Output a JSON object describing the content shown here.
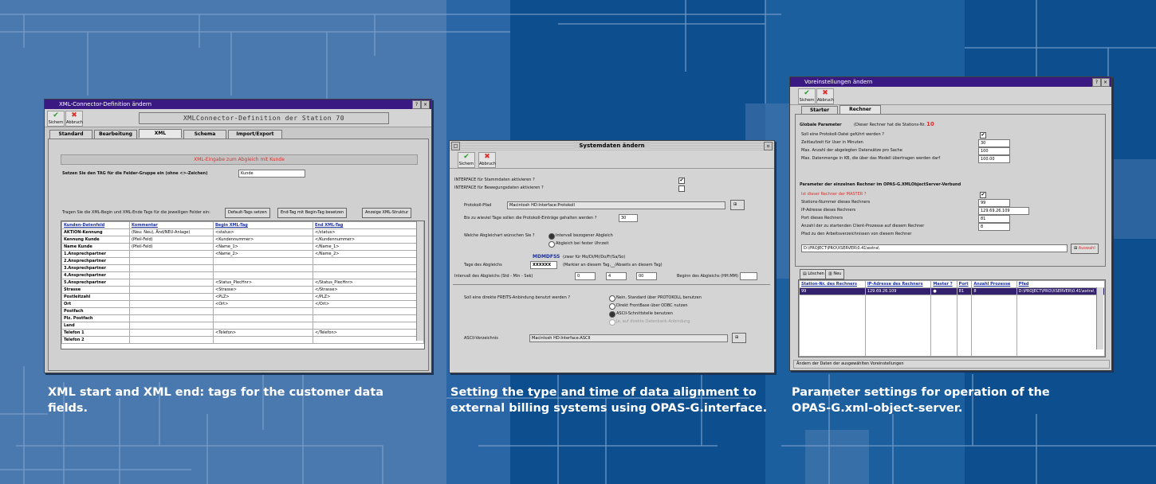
{
  "captions": {
    "left": [
      "XML start and XML end: tags for the customer data",
      "fields."
    ],
    "middle": [
      "Setting the type and time of data alignment to",
      "external billing systems using OPAS-G.interface."
    ],
    "right": [
      "Parameter settings for operation of the",
      "OPAS-G.xml-object-server."
    ]
  },
  "colors": {
    "bg_light": "#4a79b0",
    "bg_dark": "#0d4f8e",
    "bg_mid": "#1c5f9e",
    "titlebar": "#3a1a82",
    "accent_red": "#d9322c"
  },
  "toolbar": {
    "save": "Sichern",
    "cancel": "Abbruch"
  },
  "win1": {
    "title": "XML-Connector-Definition ändern",
    "header": "XMLConnector-Definition der Station 70",
    "tabs": [
      "Standard",
      "Bearbeitung",
      "XML",
      "Schema",
      "Import/Export"
    ],
    "notice": "XML-Eingabe zum Abgleich mit Kunde",
    "prompt": "Setzen Sie den TAG für die Felder-Gruppe ein (ohne <>-Zeichen)",
    "prompt_value": "Kunde",
    "hint": "Tragen Sie die XML-Begin und XML-Ende Tags für die jeweiligen Felder ein:",
    "buttons": [
      "Default-Tags setzen",
      "End-Tag mit Begin-Tag besetzen",
      "Anzeige XML-Struktur"
    ],
    "columns": [
      "Kunden-Datenfeld",
      "Kommentar",
      "Begin XML-Tag",
      "End XML-Tag"
    ],
    "rows": [
      [
        "AKTION-Kennung",
        "(Neu: Neu), Änd/NEU-Anlage)",
        "<status>",
        "</status>"
      ],
      [
        "Kennung Kunde",
        "(Pfeil-Feld)",
        "<Kundennummer>",
        "</Kundennummer>"
      ],
      [
        "Name Kunde",
        "(Pfeil-Feld)",
        "<Name_1>",
        "</Name_1>"
      ],
      [
        "1.Ansprechpartner",
        "",
        "<Name_2>",
        "</Name_2>"
      ],
      [
        "2.Ansprechpartner",
        "",
        "",
        ""
      ],
      [
        "3.Ansprechpartner",
        "",
        "",
        ""
      ],
      [
        "4.Ansprechpartner",
        "",
        "",
        ""
      ],
      [
        "5.Ansprechpartner",
        "",
        "<Status_PlecHnr>",
        "</Status_PlecHnr>"
      ],
      [
        "Strasse",
        "",
        "<Strasse>",
        "</Strasse>"
      ],
      [
        "Postleitzahl",
        "",
        "<PLZ>",
        "</PLZ>"
      ],
      [
        "Ort",
        "",
        "<Ort>",
        "</Ort>"
      ],
      [
        "Postfach",
        "",
        "",
        ""
      ],
      [
        "Plz. Postfach",
        "",
        "",
        ""
      ],
      [
        "Land",
        "",
        "",
        ""
      ],
      [
        "Telefon 1",
        "",
        "<Telefon>",
        "</Telefon>"
      ],
      [
        "Telefon 2",
        "",
        "",
        ""
      ]
    ]
  },
  "win2": {
    "title": "Systemdaten ändern",
    "labels": [
      "INTERFACE für Stammdaten aktivieren ?",
      "INTERFACE für Bewegungsdaten aktivieren ?",
      "Protokoll-Pfad",
      "Bis zu wieviel Tage sollen die Protokoll-Einträge gehalten werden ?",
      "Welche Abgleichart wünschen Sie ?",
      "Tage des Abgleichs",
      "Intervall des Abgleichs (Std - Min - Sek)",
      "Soll eine direkte FREITS-Anbindung benutzt werden ?",
      "ASCII-Verzeichnis"
    ],
    "protocol_path": "Macintosh HD:Interface:Protokoll",
    "days": "30",
    "sync_options": [
      "Intervall bezogener Abgleich",
      "Abgleich bei fester Uhrzeit"
    ],
    "weekdays": "MDMDFSS",
    "weekdays_hint": "(zwar für Mo/Di/Mi/Do/Fr/Sa/So)",
    "day_codes": "XXXXXX",
    "day_hint": "(Markier an diesem Tag,__/Abseits an diesem Tag)",
    "interval": [
      "0",
      "4",
      "00"
    ],
    "next_label": "Beginn des Abgleichs (HH:MM)",
    "link_options": [
      "Nein, Standard über PROTOKOLL benutzen",
      "Direkt FrontBase über ODBC nutzen",
      "ASCII-Schnittstelle benutzen",
      "Ja, auf direkte Datenbank-Anbindung"
    ],
    "ascii_path": "Macintosh HD:Interface:ASCII"
  },
  "win3": {
    "title": "Voreinstellungen ändern",
    "tabs": [
      "Starter",
      "Rechner"
    ],
    "section1": "Globale Parameter",
    "section1_note": "(Dieser Rechner hat die Stations-Nr.",
    "station_no": "10",
    "rows1": [
      [
        "Soll eine Protokoll-Datei geführt werden ?",
        ""
      ],
      [
        "Zeitlaufzeit für User in Minuten",
        "30"
      ],
      [
        "Max. Anzahl der abgelegten Datensätze pro Sache",
        "100"
      ],
      [
        "Max. Datenmenge in KB, die über das Modell übertragen werden darf",
        "100.00"
      ]
    ],
    "section2": "Parameter der einzelnen Rechner im OPAS-G.XMLObjectServer-Verbund",
    "rows2": [
      [
        "Ist dieser Rechner der MASTER ?",
        ""
      ],
      [
        "Stations-Nummer dieses Rechners",
        "99"
      ],
      [
        "IP-Adresse dieses Rechners",
        "129.69.26.109"
      ],
      [
        "Port dieses Rechners",
        "81"
      ],
      [
        "Anzahl der zu startenden Client-Prozesse auf diesem Rechner",
        "8"
      ],
      [
        "Pfad zu den Arbeitsverzeichnissen von diesem Rechner",
        ""
      ]
    ],
    "path_value": "D:\\PROJECT\\PRO\\XSERVER\\0.41\\extra\\",
    "choose_btn": "Auswahl",
    "list_buttons": [
      "Löschen",
      "Neu"
    ],
    "columns": [
      "Station-Nr. des Rechners",
      "IP-Adresse des Rechners",
      "Master ?",
      "Port",
      "Anzahl Prozesse",
      "Pfad"
    ],
    "row": [
      "99",
      "129.69.26.109",
      "",
      "81",
      "8",
      "D:\\PROJECT\\PRO\\XSERVER\\0.41\\extra\\"
    ],
    "status": "Ändern der Daten der ausgewählten Voreinstellungen"
  }
}
